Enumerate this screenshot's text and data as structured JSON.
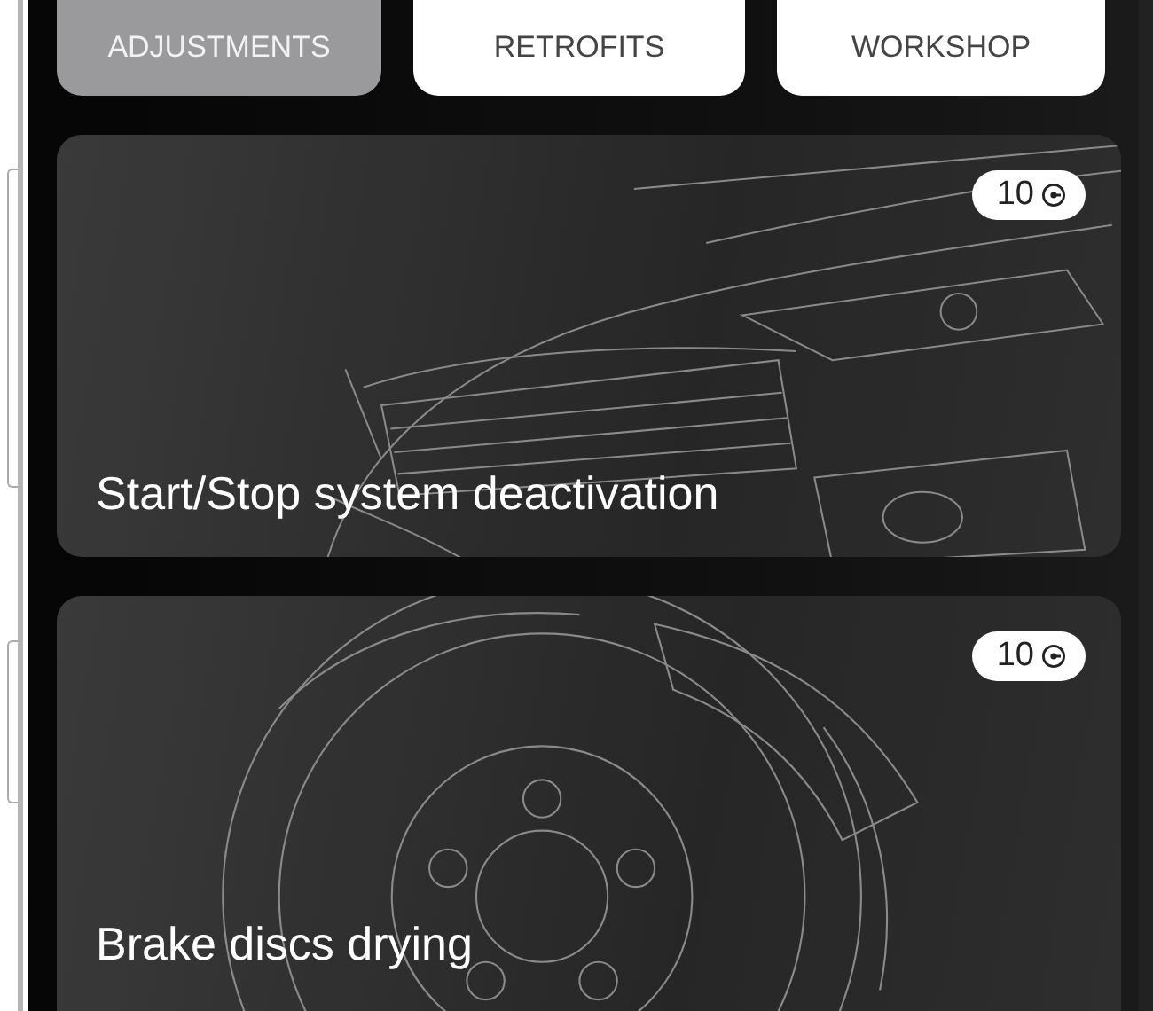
{
  "tabs": [
    {
      "label": "ADJUSTMENTS",
      "selected": true
    },
    {
      "label": "RETROFITS",
      "selected": false
    },
    {
      "label": "WORKSHOP",
      "selected": false
    }
  ],
  "cards": [
    {
      "kind": "car",
      "title": "Start/Stop system deactivation",
      "badge": "10"
    },
    {
      "kind": "brake-disc",
      "title": "Brake discs drying",
      "badge": "10"
    }
  ]
}
